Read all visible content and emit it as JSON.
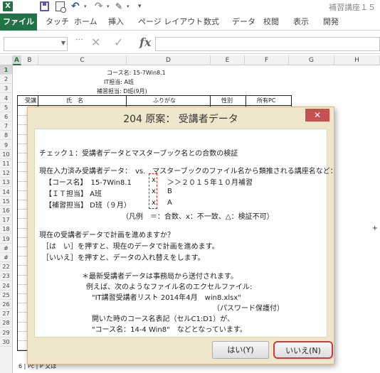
{
  "app": {
    "logo": "X",
    "doc_title": "補習講座１５"
  },
  "icons": {
    "logo": "excel-logo-icon",
    "save": "save-icon",
    "preview": "print-preview-icon",
    "undo": "undo-icon",
    "redo": "redo-icon",
    "format_painter": "brush-icon",
    "customize": "chevron-down-icon"
  },
  "ribbon": {
    "tabs": [
      {
        "label": "ファイル"
      },
      {
        "label": "タッチ"
      },
      {
        "label": "ホーム"
      },
      {
        "label": "挿入"
      },
      {
        "label": "ページ レイアウト"
      },
      {
        "label": "数式"
      },
      {
        "label": "データ"
      },
      {
        "label": "校閲"
      },
      {
        "label": "表示"
      },
      {
        "label": "開発"
      }
    ]
  },
  "formula_bar": {
    "namebox_value": "",
    "formula_value": "",
    "cancel_glyph": "✕",
    "enter_glyph": "✓",
    "fx_label": "fx"
  },
  "sheet": {
    "columns": [
      "A",
      "B",
      "C",
      "D",
      "E",
      "F",
      "G",
      "H"
    ],
    "rows": [
      "1",
      "2",
      "3",
      "4",
      "5",
      "6",
      "7",
      "8",
      "9",
      "10",
      "11",
      "12",
      "13",
      "14",
      "15",
      "16",
      "17",
      "18",
      "19",
      "#",
      "#",
      "22",
      "23",
      "24",
      "25",
      "26",
      "27",
      "28",
      "29",
      "30"
    ],
    "cells": {
      "course_name": "コース名: 15-7Win8.1",
      "it_staff": "IT担当: A班",
      "tutor_staff": "補習担当: D班(9月)"
    },
    "table_headers": [
      "受講",
      "氏　名",
      "ふりがな",
      "性別",
      "所有PC"
    ],
    "bottom_fragment": "6 | Pc | P 又は"
  },
  "dialog": {
    "title": "204 原案： 受講者データ",
    "close_label": "✕",
    "lines": [
      "チェック１：受講者データとマスターブック名との合数の検証",
      "現在入力済み受講者データ：　vs.　マスターブックのファイル名から類推される講座名など：",
      "【コース名】　15-7Win8.1",
      "x",
      "＞＞２０１５年１０月補習",
      "【ＩＴ担当】 A班",
      "x",
      "B",
      "【補習担当】 D班（９月）",
      "x",
      "A",
      "（凡例　＝：合数、x：不一致、△：検証不可）",
      "現在の受講者データで計画を進めますか？",
      "［は　い］を押すと、現在のデータで計画を進めます。",
      "［いいえ］を押すと、データの入れ替えをします。",
      "＊最新受講者データは事務局から送付されます。",
      "例えば、次のようなファイル名のエクセルファイル:",
      "\"IT講習受講者リスト 2014年4月　win8.xlsx\"",
      "（パスワード保護付）",
      "開いた時のコース名表記（セルC1:D1）が、",
      "\"コース名：14-4 Win8\"　などとなっています。"
    ],
    "buttons": {
      "yes": "はい(Y)",
      "no": "いいえ(N)"
    }
  },
  "colors": {
    "excel_green": "#217346",
    "dialog_frame": "#f0e6cc",
    "close_red": "#c75050",
    "highlight_red": "#d0393c"
  }
}
